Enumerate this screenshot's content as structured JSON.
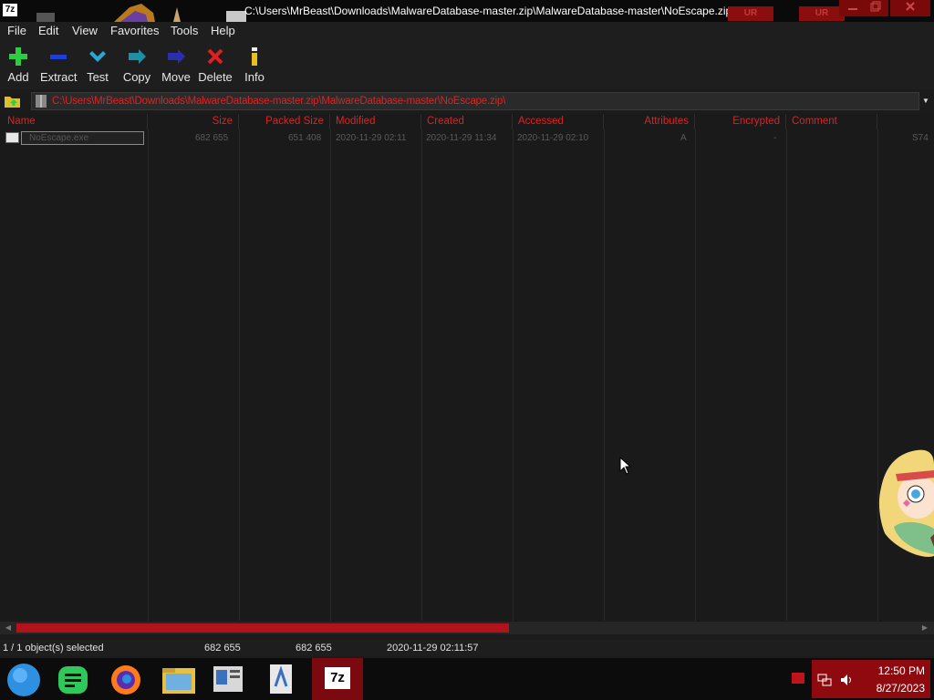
{
  "window": {
    "title": "C:\\Users\\MrBeast\\Downloads\\MalwareDatabase-master.zip\\MalwareDatabase-master\\NoEscape.zip\\",
    "app_icon_text": "7z",
    "title_tab_label": "UR"
  },
  "menu": [
    "File",
    "Edit",
    "View",
    "Favorites",
    "Tools",
    "Help"
  ],
  "toolbar": [
    {
      "label": "Add",
      "icon": "add-icon"
    },
    {
      "label": "Extract",
      "icon": "extract-icon"
    },
    {
      "label": "Test",
      "icon": "test-icon"
    },
    {
      "label": "Copy",
      "icon": "copy-icon"
    },
    {
      "label": "Move",
      "icon": "move-icon"
    },
    {
      "label": "Delete",
      "icon": "delete-icon"
    },
    {
      "label": "Info",
      "icon": "info-icon"
    }
  ],
  "address": {
    "path": "C:\\Users\\MrBeast\\Downloads\\MalwareDatabase-master.zip\\MalwareDatabase-master\\NoEscape.zip\\"
  },
  "columns": [
    "Name",
    "Size",
    "Packed Size",
    "Modified",
    "Created",
    "Accessed",
    "Attributes",
    "Encrypted",
    "Comment"
  ],
  "row": {
    "name": "NoEscape.exe",
    "size": "682 655",
    "packed_size": "651 408",
    "modified": "2020-11-29 02:11",
    "created": "2020-11-29 11:34",
    "accessed": "2020-11-29 02:10",
    "attributes": "A",
    "encrypted": "-",
    "trailing": "S74"
  },
  "status": {
    "selection": "1 / 1 object(s) selected",
    "size": "682 655",
    "packed": "682 655",
    "modified": "2020-11-29 02:11:57"
  },
  "taskbar": {
    "time": "12:50 PM",
    "date": "8/27/2023",
    "active_app_text": "7z"
  },
  "colors": {
    "accent_red": "#d82424",
    "scroll_red": "#b0141a",
    "tray_red": "#8f0a0e",
    "background": "#1b1b1b"
  }
}
